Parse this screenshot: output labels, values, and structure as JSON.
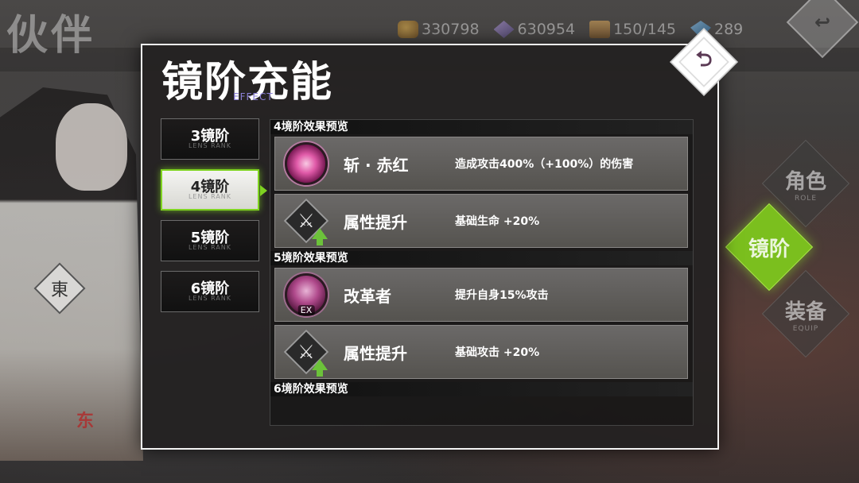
{
  "background": {
    "screen_title": "伙伴",
    "char_mark": "東",
    "logo_text": "东"
  },
  "resources": [
    {
      "icon": "gold-coin-icon",
      "value": "330798"
    },
    {
      "icon": "crystal-icon",
      "value": "630954"
    },
    {
      "icon": "chest-icon",
      "value": "150/145"
    },
    {
      "icon": "gem-icon",
      "value": "289"
    }
  ],
  "side_nav": {
    "role": {
      "label": "角色",
      "sub": "ROLE"
    },
    "rank": {
      "label": "镜阶",
      "sub": ""
    },
    "equip": {
      "label": "装备",
      "sub": "EQUIP"
    }
  },
  "panel": {
    "title": "镜阶充能",
    "subtitle": "EFFECT",
    "tabs": [
      {
        "label": "3镜阶",
        "sub": "LENS RANK",
        "active": false
      },
      {
        "label": "4镜阶",
        "sub": "LENS RANK",
        "active": true
      },
      {
        "label": "5镜阶",
        "sub": "LENS RANK",
        "active": false
      },
      {
        "label": "6镜阶",
        "sub": "LENS RANK",
        "active": false
      }
    ],
    "sections": [
      {
        "header": "4境阶效果预览",
        "rows": [
          {
            "name": "斩 · 赤红",
            "desc": "造成攻击400%（+100%）的伤害",
            "icon": "skill-slash-icon"
          },
          {
            "name": "属性提升",
            "desc": "基础生命 +20%",
            "icon": "attribute-up-icon"
          }
        ]
      },
      {
        "header": "5境阶效果预览",
        "rows": [
          {
            "name": "改革者",
            "desc": "提升自身15%攻击",
            "icon": "skill-ex-icon",
            "badge": "EX"
          },
          {
            "name": "属性提升",
            "desc": "基础攻击 +20%",
            "icon": "attribute-up-icon"
          }
        ]
      },
      {
        "header": "6境阶效果预览",
        "rows": []
      }
    ]
  },
  "colors": {
    "accent_green": "#7fd321",
    "panel_border": "#f4f4f4",
    "subtitle_purple": "#8a7fd6"
  }
}
